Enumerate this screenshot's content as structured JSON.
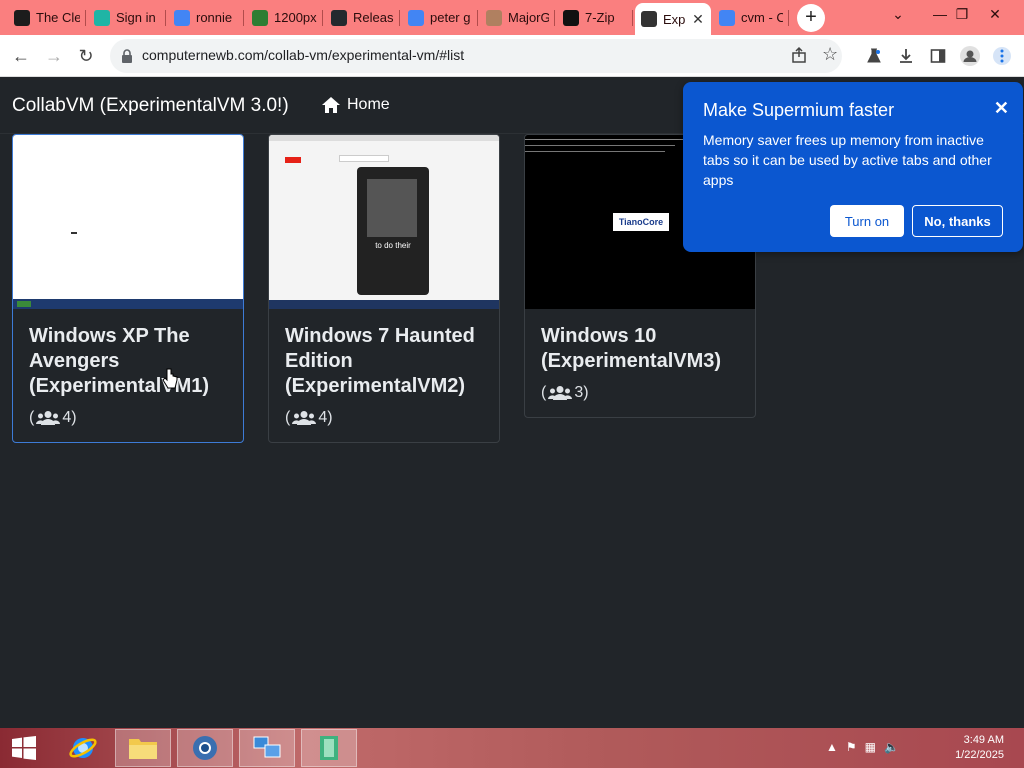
{
  "browser": {
    "tabs": [
      {
        "label": "The Cle",
        "favicon": "tbc-favicon",
        "color": "#1c1c1c"
      },
      {
        "label": "Sign in",
        "favicon": "signin-favicon",
        "color": "#1fb5a5"
      },
      {
        "label": "ronnie",
        "favicon": "google-favicon",
        "color": "#4285f4"
      },
      {
        "label": "1200px",
        "favicon": "wikimedia-favicon",
        "color": "#2e7d32"
      },
      {
        "label": "Release",
        "favicon": "github-favicon",
        "color": "#24292e"
      },
      {
        "label": "peter g",
        "favicon": "google-favicon",
        "color": "#4285f4"
      },
      {
        "label": "MajorG",
        "favicon": "majorg-favicon",
        "color": "#b08060"
      },
      {
        "label": "7-Zip",
        "favicon": "7zip-favicon",
        "color": "#111111"
      },
      {
        "label": "Exp",
        "favicon": "collabvm-favicon",
        "color": "#333333"
      },
      {
        "label": "cvm - C",
        "favicon": "google-favicon",
        "color": "#4285f4"
      }
    ],
    "new_tab_label": "+",
    "url": "computernewb.com/collab-vm/experimental-vm/#list"
  },
  "navbar": {
    "brand": "CollabVM (ExperimentalVM 3.0!)",
    "home_label": "Home"
  },
  "vms": [
    {
      "title": "Windows XP The Avengers (ExperimentalVM1)",
      "users_open": "(",
      "users_count": "4)"
    },
    {
      "title": "Windows 7 Haunted Edition (ExperimentalVM2)",
      "users_open": "(",
      "users_count": "4)"
    },
    {
      "title": "Windows 10 (ExperimentalVM3)",
      "users_open": "(",
      "users_count": "3)"
    }
  ],
  "thumbnails": {
    "vm2_caption": "to do their",
    "vm3_logo": "TianoCore"
  },
  "popup": {
    "title": "Make Supermium faster",
    "body": "Memory saver frees up memory from inactive tabs so it can be used by active tabs and other apps",
    "turn_on": "Turn on",
    "no_thanks": "No, thanks",
    "bg_color": "#0b57d0"
  },
  "taskbar": {
    "time": "3:49 AM",
    "date": "1/22/2025"
  }
}
